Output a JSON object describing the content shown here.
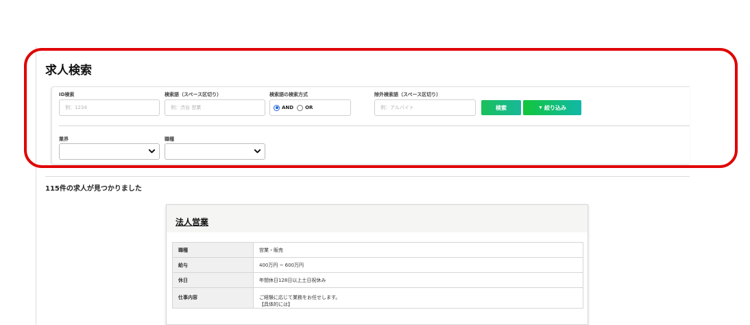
{
  "page": {
    "title": "求人検索"
  },
  "search": {
    "id_label": "ID検索",
    "id_placeholder": "例：1234",
    "keyword_label": "検索語（スペース区切り）",
    "keyword_placeholder": "例：渋谷 営業",
    "mode_label": "検索語の検索方式",
    "mode_options": [
      "AND",
      "OR"
    ],
    "mode_selected": "AND",
    "exclude_label": "除外検索語（スペース区切り）",
    "exclude_placeholder": "例：アルバイト",
    "search_button": "検索",
    "filter_button": "絞り込み",
    "industry_label": "業界",
    "industry_value": "",
    "occupation_label": "職種",
    "occupation_value": ""
  },
  "results": {
    "count_text": "115件の求人が見つかりました"
  },
  "job": {
    "title": "法人営業",
    "rows": [
      {
        "key": "職種",
        "value": "営業・販売"
      },
      {
        "key": "給与",
        "value": "400万円 ~ 600万円"
      },
      {
        "key": "休日",
        "value": "年間休日128日以上土日祝休み"
      },
      {
        "key": "仕事内容",
        "value": "ご経験に応じて業務をお任せします。",
        "value2": "【具体的には】"
      }
    ]
  },
  "colors": {
    "highlight": "#e00000",
    "search_button": "#19c05a",
    "filter_button": "#12c53a",
    "radio_accent": "#1a62d8"
  },
  "icons": {
    "filter": "filter-triangle-icon",
    "select_arrow": "chevron-down-icon"
  }
}
